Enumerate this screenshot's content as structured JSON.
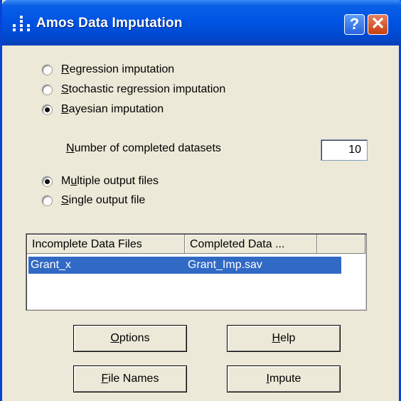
{
  "window": {
    "title": "Amos Data Imputation",
    "help_symbol": "?",
    "close_symbol": "✕"
  },
  "imputation_methods": [
    {
      "label_first": "R",
      "label_rest": "egression imputation",
      "selected": false
    },
    {
      "label_first": "S",
      "label_rest": "tochastic regression imputation",
      "selected": false
    },
    {
      "label_first": "B",
      "label_rest": "ayesian imputation",
      "selected": true
    }
  ],
  "datasets": {
    "label_first": "N",
    "label_rest": "umber of completed datasets",
    "value": "10"
  },
  "output_options": [
    {
      "label_pre": "M",
      "label_u": "u",
      "label_rest": "ltiple output files",
      "selected": true
    },
    {
      "label_pre": "",
      "label_u": "S",
      "label_rest": "ingle output file",
      "selected": false
    }
  ],
  "file_list": {
    "columns": [
      "Incomplete Data Files",
      "Completed Data ..."
    ],
    "rows": [
      {
        "incomplete": "Grant_x",
        "completed": "Grant_Imp.sav",
        "selected": true
      }
    ]
  },
  "buttons": {
    "options": {
      "u": "O",
      "rest": "ptions"
    },
    "help": {
      "u": "H",
      "rest": "elp"
    },
    "file_names": {
      "u": "F",
      "rest": "ile Names"
    },
    "impute": {
      "u": "I",
      "rest": "mpute"
    }
  },
  "colors": {
    "titlebar": "#0054e3",
    "selection": "#316ac5",
    "dialog_bg": "#ece9d8"
  }
}
